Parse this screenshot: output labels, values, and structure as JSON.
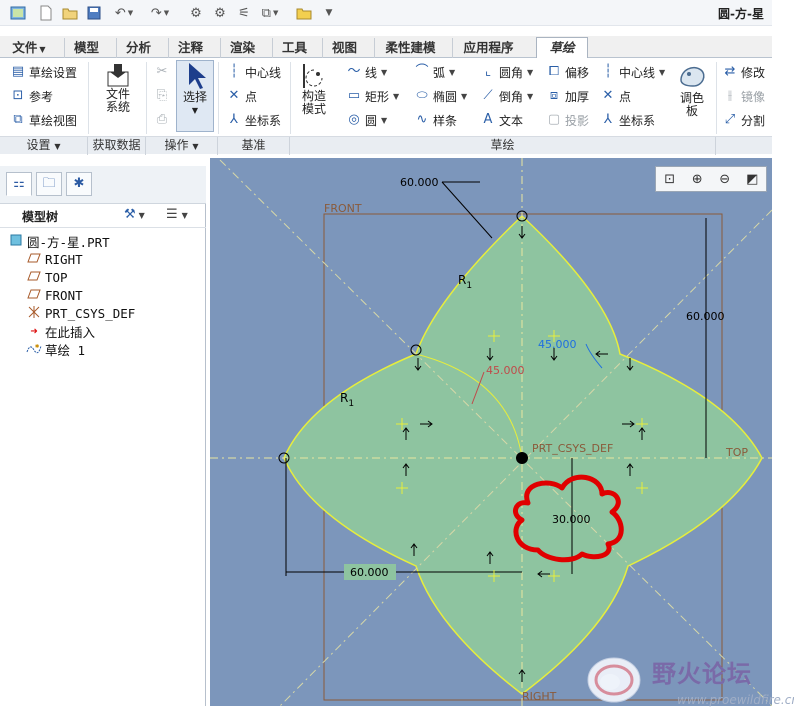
{
  "window": {
    "title": "圆-方-星"
  },
  "quick_access": {
    "icons": [
      "app-icon",
      "new-icon",
      "open-icon",
      "save-icon",
      "undo-icon",
      "redo-icon",
      "regenerate-icon",
      "regenerate-manager-icon",
      "windows-icon",
      "close-window-icon",
      "customize-icon"
    ]
  },
  "tabs": [
    {
      "label": "文件",
      "dropdown": true
    },
    {
      "label": "模型"
    },
    {
      "label": "分析"
    },
    {
      "label": "注释"
    },
    {
      "label": "渲染"
    },
    {
      "label": "工具"
    },
    {
      "label": "视图"
    },
    {
      "label": "柔性建模"
    },
    {
      "label": "应用程序"
    },
    {
      "label": "草绘",
      "active": true
    }
  ],
  "ribbon": {
    "setup": {
      "sketch_setup": "草绘设置",
      "references": "参考",
      "sketch_view": "草绘视图"
    },
    "get_data": {
      "file_system": "文件系统"
    },
    "operations": {
      "select": "选择",
      "cut": "✂",
      "copy": "⎘",
      "paste": "⎙"
    },
    "datum": {
      "centerline": "中心线",
      "point": "点",
      "coordinate_system": "坐标系"
    },
    "sketch": {
      "construction_mode": "构造模式",
      "line": "线",
      "arc": "弧",
      "fillet": "圆角",
      "offset": "偏移",
      "centerline": "中心线",
      "rectangle": "矩形",
      "ellipse": "椭圆",
      "chamfer": "倒角",
      "thicken": "加厚",
      "point": "点",
      "circle": "圆",
      "spline": "样条",
      "text": "文本",
      "project": "投影",
      "coordinate_system": "坐标系",
      "palette": "调色板"
    },
    "editing": {
      "modify": "修改",
      "mirror": "镜像",
      "divide": "分割"
    },
    "groups": [
      "设置",
      "获取数据",
      "操作",
      "基准",
      "草绘"
    ]
  },
  "model_tree": {
    "title": "模型树",
    "items": [
      {
        "label": "圆-方-星.PRT",
        "icon": "part-icon"
      },
      {
        "label": "RIGHT",
        "icon": "datum-plane-icon"
      },
      {
        "label": "TOP",
        "icon": "datum-plane-icon"
      },
      {
        "label": "FRONT",
        "icon": "datum-plane-icon"
      },
      {
        "label": "PRT_CSYS_DEF",
        "icon": "csys-icon"
      },
      {
        "label": "在此插入",
        "icon": "insert-here-arrow-icon"
      },
      {
        "label": "草绘 1",
        "icon": "sketch-icon"
      }
    ]
  },
  "canvas": {
    "view_tools": [
      "refit-icon",
      "zoom-in-icon",
      "zoom-out-icon",
      "repaint-icon"
    ],
    "labels": {
      "front": "FRONT",
      "top": "TOP",
      "right": "RIGHT",
      "csys": "PRT_CSYS_DEF",
      "r1_top": "R",
      "r1_top_sub": "1",
      "r1_left": "R",
      "r1_left_sub": "1"
    },
    "dimensions": {
      "top_width": "60.000",
      "right_height": "60.000",
      "bottom_width": "60.000",
      "radius": "30.000",
      "angle_blue": "45.000",
      "angle_red": "45.000"
    },
    "colors": {
      "background": "#7c96bb",
      "petal_fill": "#8ec4a0",
      "petal_edge": "#e7ee3c",
      "dim_line": "#000000",
      "angle_blue": "#1f6fe0",
      "angle_red": "#c04a4a",
      "highlight": "#e00000"
    }
  },
  "watermark": {
    "text": "野火论坛",
    "url": "www.proewildfire.cn"
  }
}
